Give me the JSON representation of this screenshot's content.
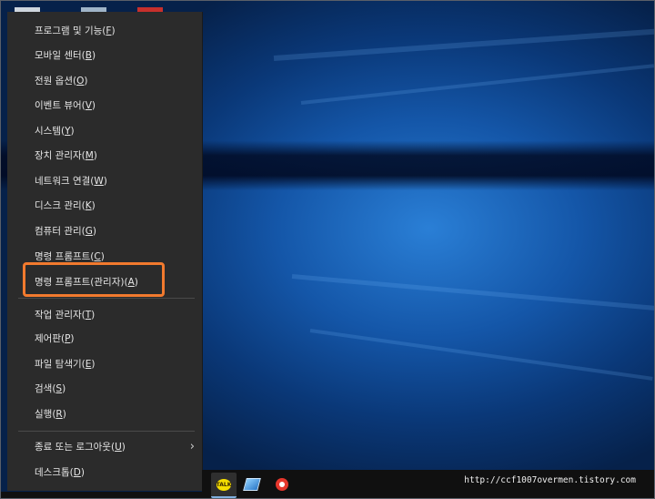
{
  "start_context_menu": {
    "items": [
      {
        "text": "프로그램 및 기능",
        "key": "F"
      },
      {
        "text": "모바일 센터",
        "key": "B"
      },
      {
        "text": "전원 옵션",
        "key": "O"
      },
      {
        "text": "이벤트 뷰어",
        "key": "V"
      },
      {
        "text": "시스템",
        "key": "Y"
      },
      {
        "text": "장치 관리자",
        "key": "M"
      },
      {
        "text": "네트워크 연결",
        "key": "W"
      },
      {
        "text": "디스크 관리",
        "key": "K"
      },
      {
        "text": "컴퓨터 관리",
        "key": "G"
      },
      {
        "text": "명령 프롬프트",
        "key": "C"
      },
      {
        "text": "명령 프롬프트(관리자)",
        "key": "A"
      },
      {
        "text": "작업 관리자",
        "key": "T"
      },
      {
        "text": "제어판",
        "key": "P"
      },
      {
        "text": "파일 탐색기",
        "key": "E"
      },
      {
        "text": "검색",
        "key": "S"
      },
      {
        "text": "실행",
        "key": "R"
      },
      {
        "text": "종료 또는 로그아웃",
        "key": "U"
      },
      {
        "text": "데스크톱",
        "key": "D"
      }
    ],
    "highlight_color": "#f27a2e"
  },
  "taskbar": {
    "kakao_icon_text": "TALK",
    "watermark": "http://ccf1007overmen.tistory.com"
  },
  "colors": {
    "menu_bg": "#2b2b2b",
    "desktop_blue": "#1456a8"
  }
}
